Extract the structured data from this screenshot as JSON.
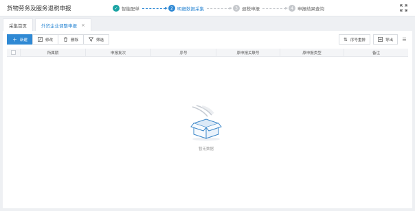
{
  "app": {
    "title": "货物劳务及服务退税申报"
  },
  "steps": [
    {
      "num": "✓",
      "label": "智能配单",
      "state": "done"
    },
    {
      "num": "2",
      "label": "明细数据采集",
      "state": "active"
    },
    {
      "num": "3",
      "label": "退税申报",
      "state": "todo"
    },
    {
      "num": "4",
      "label": "申报结果查询",
      "state": "todo"
    }
  ],
  "tabs": {
    "home": "采集首页",
    "open": "外贸企业调整申报",
    "close": "×"
  },
  "toolbar": {
    "new": "新建",
    "edit": "修改",
    "delete": "删除",
    "filter": "筛选",
    "reorder": "序号重排",
    "export": "导出"
  },
  "table": {
    "headers": [
      "所属期",
      "申报批次",
      "序号",
      "原申报关联号",
      "原申报类型",
      "备注"
    ]
  },
  "empty": {
    "text": "暂无数据"
  },
  "colors": {
    "primary": "#2f89d4",
    "done": "#1aa3a3"
  }
}
